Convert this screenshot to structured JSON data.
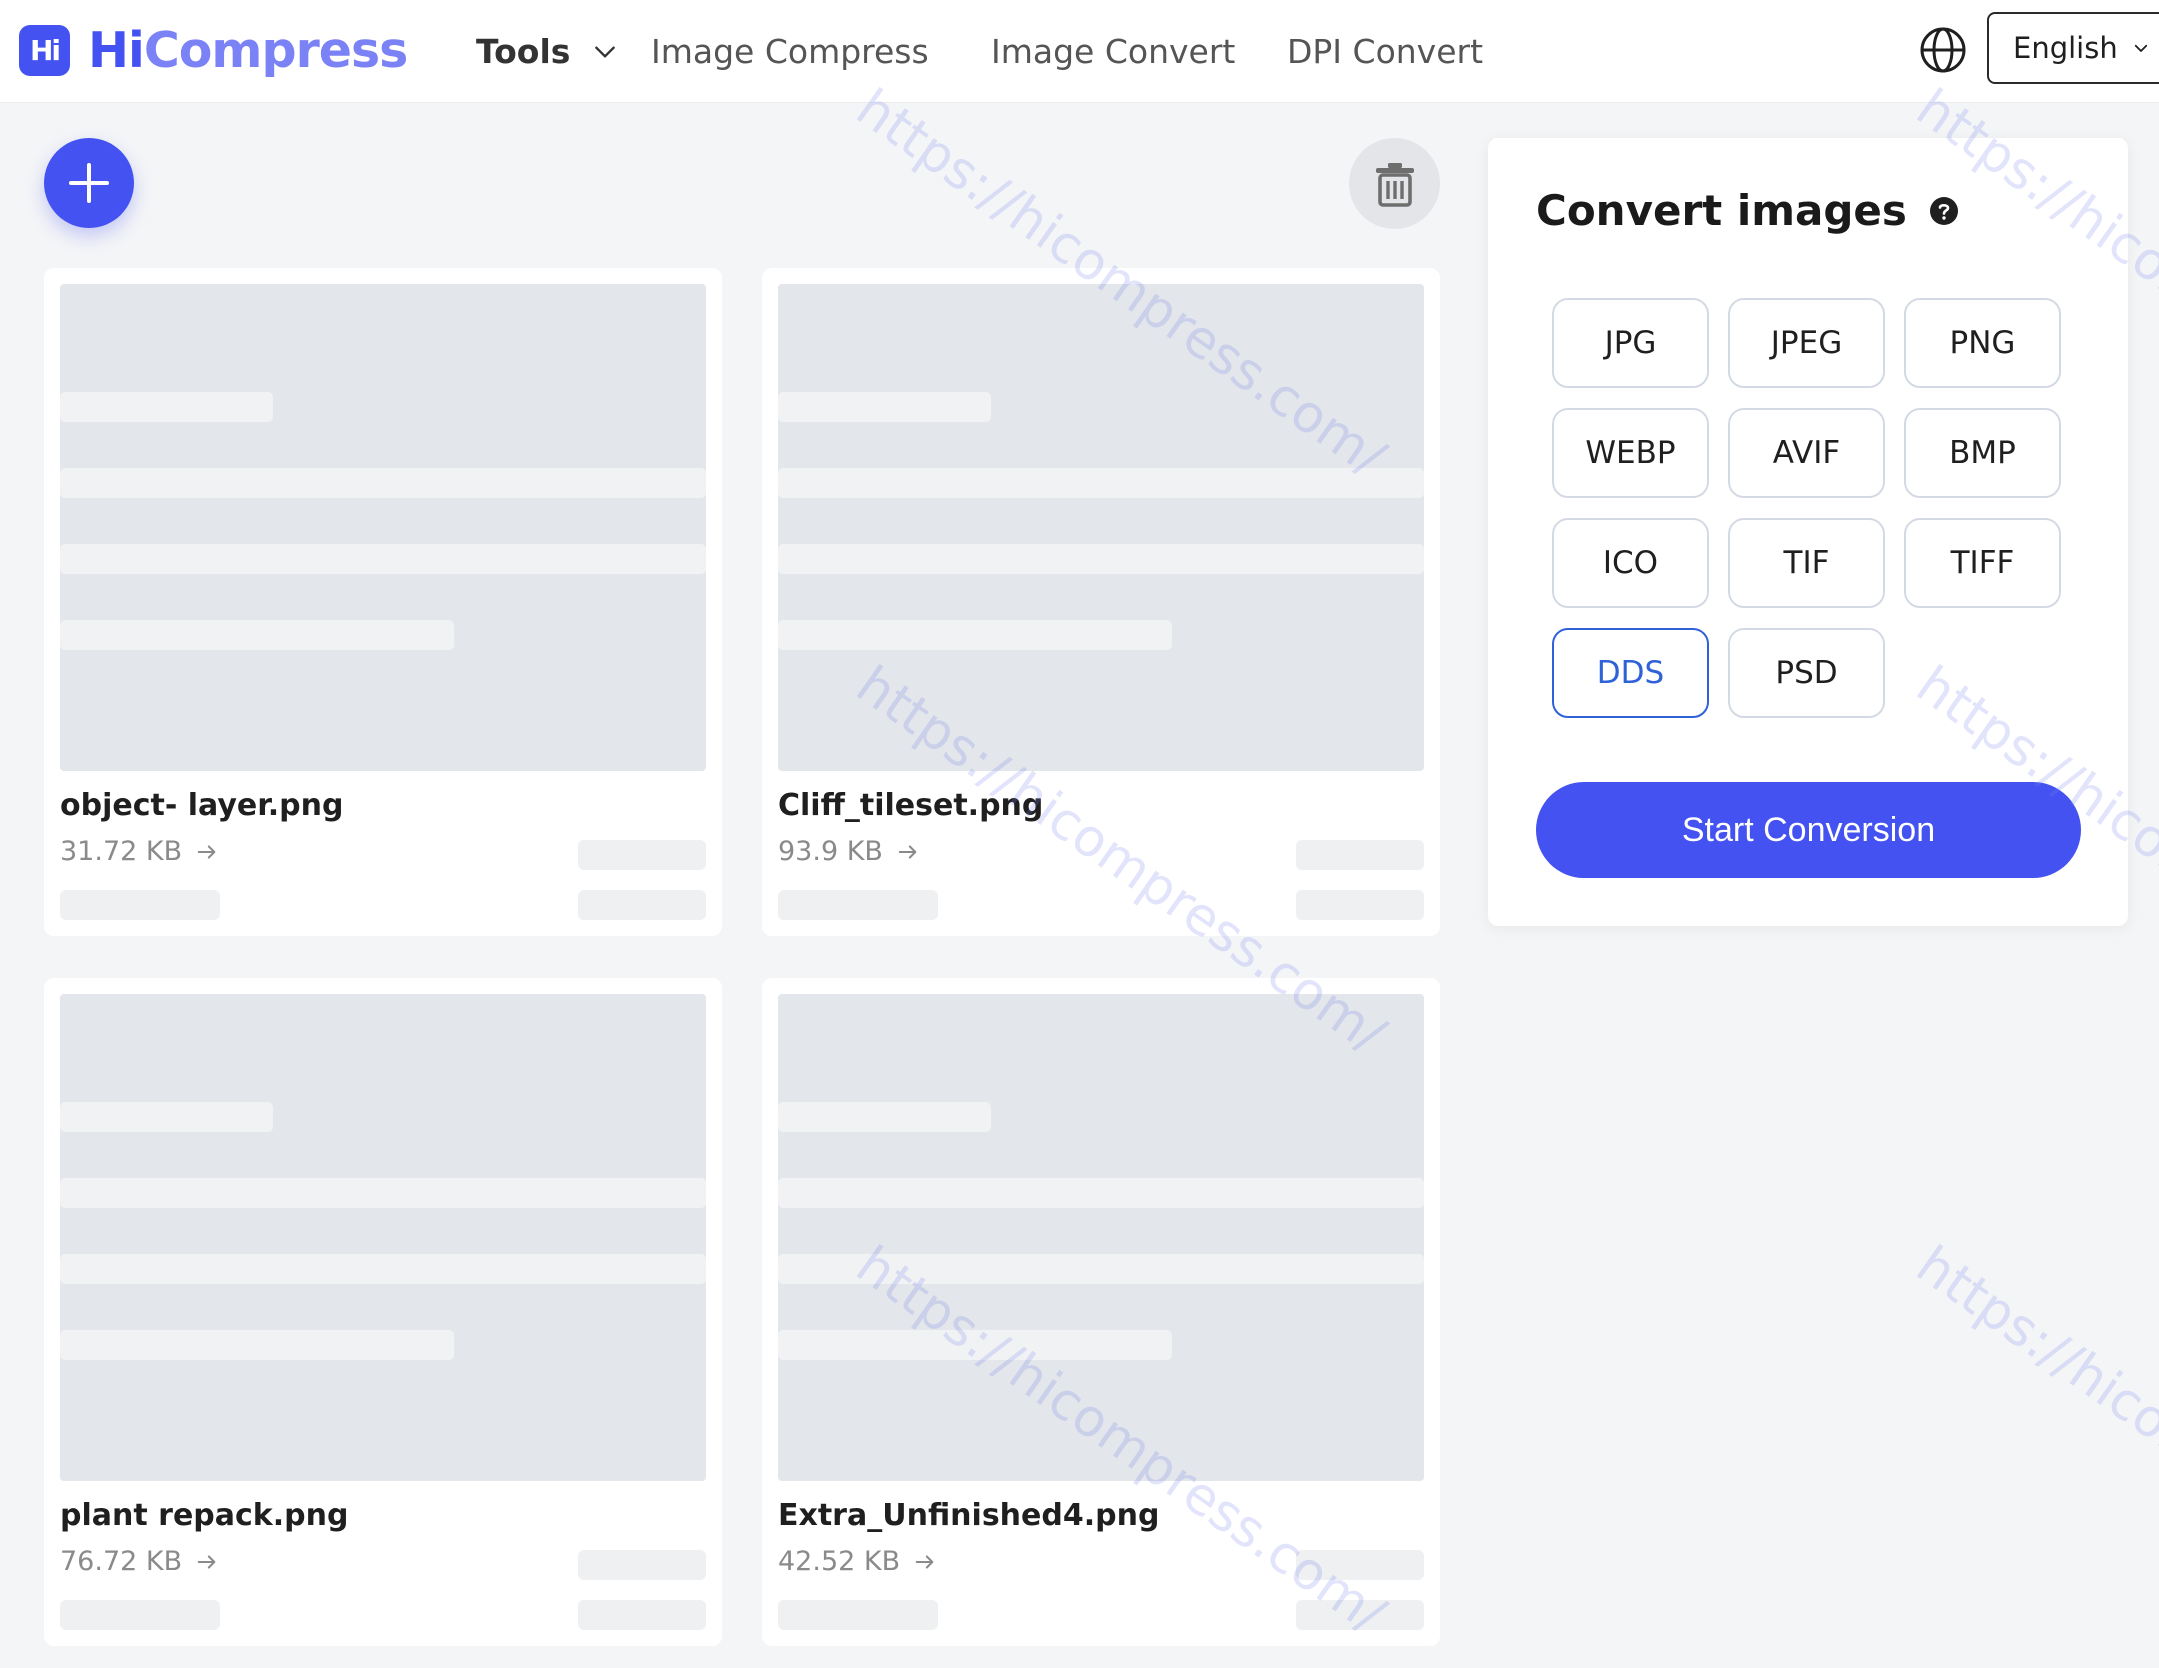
{
  "header": {
    "logo_mark": "Hi",
    "logo_hi": "Hi",
    "logo_rest": "Compress",
    "nav": {
      "tools": "Tools",
      "image_compress": "Image Compress",
      "image_convert": "Image Convert",
      "dpi_convert": "DPI Convert"
    },
    "language": "English",
    "icons": {
      "globe": "globe-icon",
      "chevron": "chevron-down-icon"
    }
  },
  "toolbar": {
    "add_icon": "plus-icon",
    "delete_icon": "trash-icon"
  },
  "files": [
    {
      "name": "object- layer.png",
      "size": "31.72 KB"
    },
    {
      "name": "Cliff_tileset.png",
      "size": "93.9 KB"
    },
    {
      "name": "plant repack.png",
      "size": "76.72 KB"
    },
    {
      "name": "Extra_Unfinished4.png",
      "size": "42.52 KB"
    }
  ],
  "panel": {
    "title": "Convert images",
    "help_icon": "question-circle-icon",
    "formats": [
      "JPG",
      "JPEG",
      "PNG",
      "WEBP",
      "AVIF",
      "BMP",
      "ICO",
      "TIF",
      "TIFF",
      "DDS",
      "PSD"
    ],
    "selected_format": "DDS",
    "start_label": "Start Conversion"
  },
  "watermark": "https://hicompress.com/",
  "colors": {
    "brand": "#4352f0",
    "brand_light": "#7b82f5",
    "selected_border": "#2f62d8",
    "background": "#f4f5f7"
  }
}
